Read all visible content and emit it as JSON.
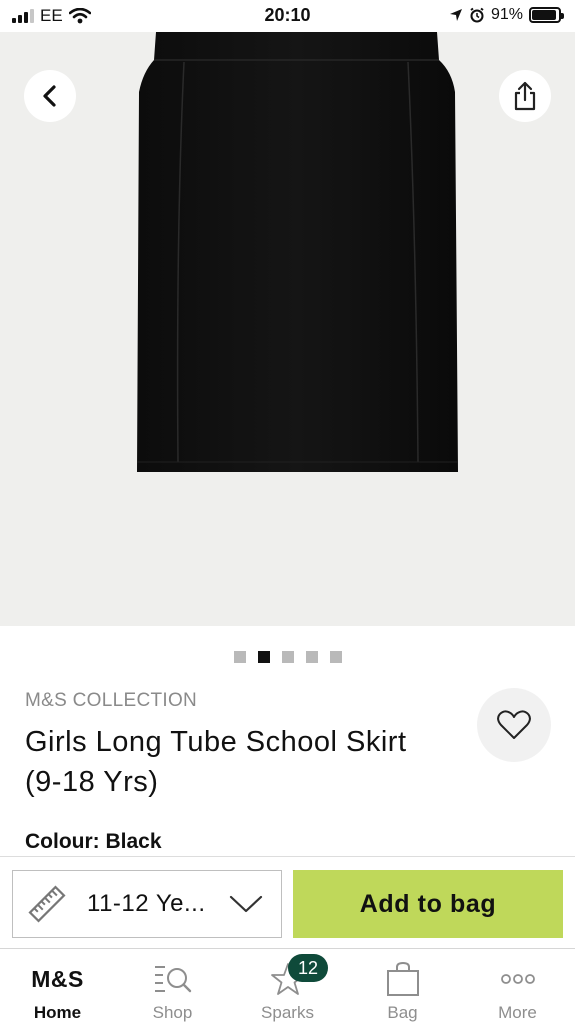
{
  "status_bar": {
    "carrier": "EE",
    "time": "20:10",
    "battery": "91%",
    "battery_level": 0.91,
    "icons": [
      "signal-icon",
      "wifi-icon",
      "location-icon",
      "alarm-icon",
      "battery-icon"
    ]
  },
  "gallery": {
    "image_description_icon": "product-image",
    "page_count": 5,
    "active_index": 1
  },
  "product": {
    "brand": "M&S COLLECTION",
    "title": "Girls Long Tube School Skirt (9-18 Yrs)",
    "colour_label": "Colour: Black"
  },
  "actions": {
    "size_value": "11-12 Ye...",
    "add_to_bag_label": "Add to bag"
  },
  "colors": {
    "add_button": "#bfd85a",
    "badge": "#0f4a3a",
    "image_bg": "#efefed"
  },
  "tabs": [
    {
      "label": "Home",
      "icon": "ms-logo",
      "logo_text": "M&S"
    },
    {
      "label": "Shop",
      "icon": "shop-search-icon"
    },
    {
      "label": "Sparks",
      "icon": "sparks-star-icon",
      "badge": "12"
    },
    {
      "label": "Bag",
      "icon": "bag-icon"
    },
    {
      "label": "More",
      "icon": "more-icon"
    }
  ]
}
